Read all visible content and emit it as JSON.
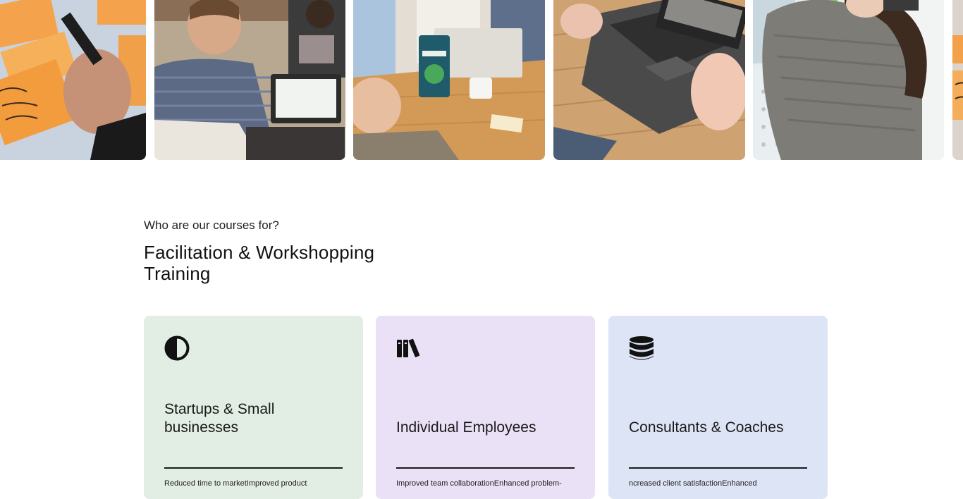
{
  "section": {
    "eyebrow": "Who are our courses for?",
    "title": "Facilitation & Workshopping Training"
  },
  "cards": [
    {
      "icon": "contrast-icon",
      "color": "#e2ede3",
      "title": "Startups & Small businesses",
      "text": "Reduced time to marketImproved product"
    },
    {
      "icon": "books-icon",
      "color": "#ebe1f7",
      "title": "Individual Employees",
      "text": "Improved team collaborationEnhanced problem-"
    },
    {
      "icon": "database-icon",
      "color": "#dde4f6",
      "title": "Consultants & Coaches",
      "text": "ncreased client satisfactionEnhanced"
    }
  ]
}
